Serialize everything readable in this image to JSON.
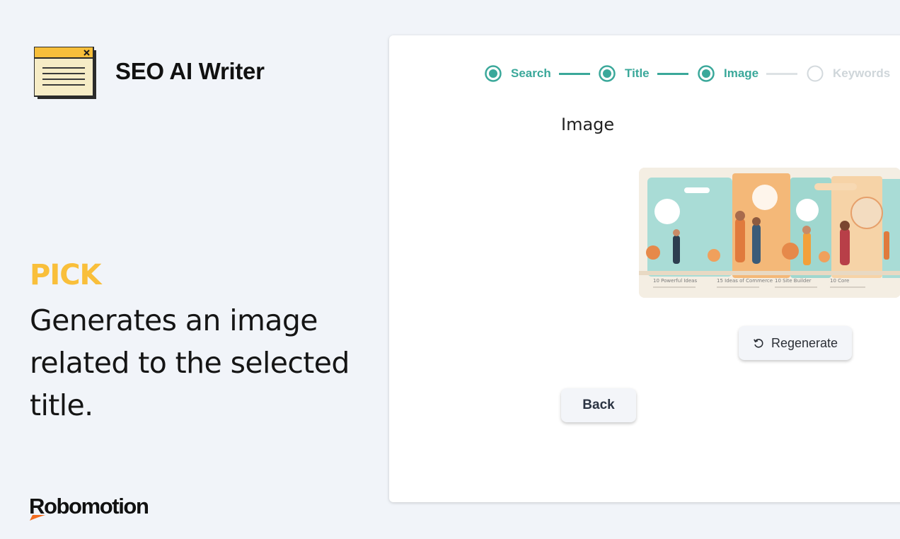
{
  "app": {
    "title": "SEO AI Writer",
    "logo_icon": "browser-window-icon"
  },
  "promo": {
    "heading": "PICK",
    "description": "Generates an image related to the selected title."
  },
  "brand": {
    "name": "Robomotion"
  },
  "stepper": {
    "steps": [
      {
        "label": "Search",
        "state": "completed"
      },
      {
        "label": "Title",
        "state": "completed"
      },
      {
        "label": "Image",
        "state": "active"
      },
      {
        "label": "Keywords",
        "state": "pending"
      }
    ]
  },
  "content": {
    "section_title": "Image",
    "image_alt": "Generated illustration of people with infographic panels",
    "image_captions": [
      "10 Powerful Ideas",
      "15 Ideas of Commerce",
      "10 Site Builder",
      "10 Core"
    ]
  },
  "buttons": {
    "regenerate": "Regenerate",
    "regenerate_icon": "refresh-icon",
    "back": "Back"
  },
  "colors": {
    "accent_teal": "#3aa89a",
    "pending_gray": "#cfd6da",
    "brand_yellow": "#f9bf3b",
    "brand_orange": "#f26b1f"
  }
}
